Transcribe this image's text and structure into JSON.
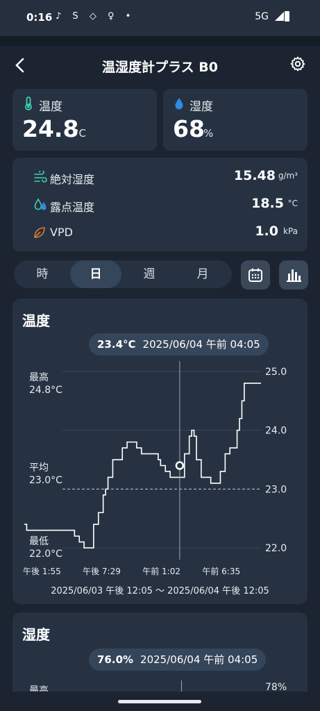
{
  "status": {
    "time": "0:16",
    "icons": "♪ S ◇ ♀ •",
    "network": "5G"
  },
  "header": {
    "title": "温湿度計プラス B0"
  },
  "temp_card": {
    "label": "温度",
    "value": "24.8",
    "unit": "°C"
  },
  "hum_card": {
    "label": "湿度",
    "value": "68",
    "unit": "%"
  },
  "metrics": [
    {
      "label": "絶対湿度",
      "value": "15.48",
      "unit": "g/m³"
    },
    {
      "label": "露点温度",
      "value": "18.5",
      "unit": "°C"
    },
    {
      "label": "VPD",
      "value": "1.0",
      "unit": "kPa"
    }
  ],
  "segments": [
    "時",
    "日",
    "週",
    "月"
  ],
  "active_segment": "日",
  "chart1": {
    "title": "温度",
    "tooltip_value": "23.4°C",
    "tooltip_time": "2025/06/04 午前 04:05",
    "max_label": "最高",
    "max_value": "24.8°C",
    "avg_label": "平均",
    "avg_value": "23.0°C",
    "min_label": "最低",
    "min_value": "22.0°C",
    "range": "2025/06/03 午後 12:05 〜 2025/06/04 午後 12:05"
  },
  "chart_data": {
    "type": "line",
    "title": "温度",
    "xlabel": "",
    "ylabel": "",
    "ylim": [
      21.8,
      25.0
    ],
    "yticks": [
      "25.0",
      "24.0",
      "23.0",
      "22.0"
    ],
    "xticks": [
      "午後 1:55",
      "午後 7:29",
      "午前 1:02",
      "午前 6:35"
    ],
    "average": 23.0,
    "grid": true,
    "series": [
      {
        "x": [
          0,
          1,
          2,
          3,
          4,
          5,
          6,
          7,
          8,
          9,
          10,
          11,
          12,
          13,
          14,
          15,
          16,
          17,
          18,
          19,
          20,
          21,
          22,
          23,
          24,
          25,
          26,
          27,
          28,
          29,
          30,
          31,
          32,
          33,
          34,
          35,
          36,
          37,
          38,
          39,
          40,
          41,
          42,
          43,
          44,
          45,
          46,
          47,
          48,
          49,
          50,
          51,
          52,
          53,
          54,
          55,
          56,
          57,
          58,
          59,
          60,
          61,
          62,
          63,
          64,
          65,
          66,
          67,
          68,
          69,
          70,
          71,
          72,
          73,
          74,
          75,
          76,
          77,
          78,
          79,
          80,
          81,
          82,
          83,
          84,
          85,
          86,
          87,
          88,
          89,
          90,
          91,
          92,
          93,
          94,
          95,
          96,
          97,
          98,
          99
        ],
        "y": [
          22.4,
          22.3,
          22.3,
          22.3,
          22.3,
          22.3,
          22.3,
          22.3,
          22.3,
          22.3,
          22.3,
          22.3,
          22.3,
          22.3,
          22.3,
          22.3,
          22.3,
          22.3,
          22.3,
          22.3,
          22.3,
          22.2,
          22.2,
          22.1,
          22.1,
          22.0,
          22.0,
          22.0,
          22.0,
          22.4,
          22.4,
          22.6,
          22.6,
          22.9,
          23.0,
          23.2,
          23.2,
          23.5,
          23.5,
          23.5,
          23.5,
          23.7,
          23.7,
          23.8,
          23.8,
          23.8,
          23.8,
          23.7,
          23.7,
          23.6,
          23.6,
          23.6,
          23.6,
          23.6,
          23.6,
          23.6,
          23.5,
          23.4,
          23.4,
          23.3,
          23.3,
          23.2,
          23.2,
          23.2,
          23.2,
          23.2,
          23.2,
          23.6,
          23.6,
          23.9,
          24.0,
          23.9,
          23.5,
          23.5,
          23.2,
          23.2,
          23.2,
          23.2,
          23.1,
          23.1,
          23.1,
          23.1,
          23.3,
          23.3,
          23.6,
          23.6,
          23.7,
          23.7,
          23.7,
          24.0,
          24.2,
          24.5,
          24.8,
          24.8,
          24.8,
          24.8,
          24.8,
          24.8,
          24.8,
          24.8
        ]
      }
    ]
  },
  "chart2": {
    "title": "湿度",
    "tooltip_value": "76.0%",
    "tooltip_time": "2025/06/04 午前 04:05",
    "max_label": "最高",
    "top_tick": "78%"
  }
}
